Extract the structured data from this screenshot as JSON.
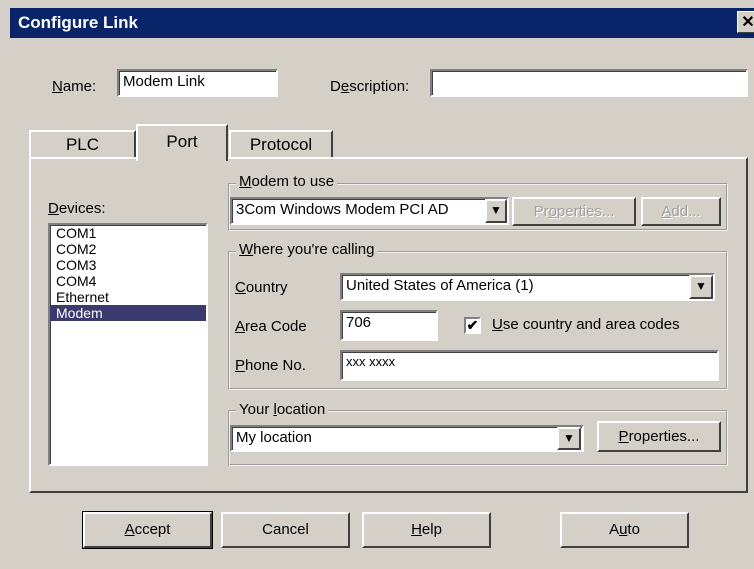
{
  "window": {
    "title": "Configure Link",
    "close_glyph": "✕"
  },
  "name": {
    "label_u": "N",
    "label_rest": "ame:",
    "value": "Modem Link"
  },
  "description": {
    "label_a": "D",
    "label_u": "e",
    "label_b": "scription:",
    "value": ""
  },
  "tabs": [
    {
      "label": "PLC",
      "active": false
    },
    {
      "label": "Port",
      "active": true
    },
    {
      "label": "Protocol",
      "active": false
    }
  ],
  "devices": {
    "label_u": "D",
    "label_rest": "evices:",
    "items": [
      "COM1",
      "COM2",
      "COM3",
      "COM4",
      "Ethernet",
      "Modem"
    ],
    "selected": "Modem"
  },
  "modem_group": {
    "legend_u": "M",
    "legend_rest": "odem to use",
    "selected": "3Com Windows Modem PCI AD",
    "properties_a": "Pr",
    "properties_u": "o",
    "properties_b": "perties...",
    "add_u": "A",
    "add_rest": "dd..."
  },
  "calling_group": {
    "legend_u": "W",
    "legend_rest": "here you're calling",
    "country_label_u": "C",
    "country_label_rest": "ountry",
    "country_value": "United States of America (1)",
    "area_label_u": "A",
    "area_label_rest": "rea Code",
    "area_value": "706",
    "use_codes_u": "U",
    "use_codes_rest": "se country and area codes",
    "use_codes_checked": true,
    "phone_label_u": "P",
    "phone_label_rest": "hone No.",
    "phone_value": "xxx xxxx"
  },
  "location_group": {
    "legend_a": "Your ",
    "legend_u": "l",
    "legend_b": "ocation",
    "value": "My location",
    "properties_u": "P",
    "properties_rest": "roperties..."
  },
  "buttons": {
    "accept_u": "A",
    "accept_rest": "ccept",
    "cancel": "Cancel",
    "help_u": "H",
    "help_rest": "elp",
    "auto_a": "A",
    "auto_u": "u",
    "auto_b": "to"
  },
  "icons": {
    "dropdown": "▼",
    "check": "✔"
  }
}
